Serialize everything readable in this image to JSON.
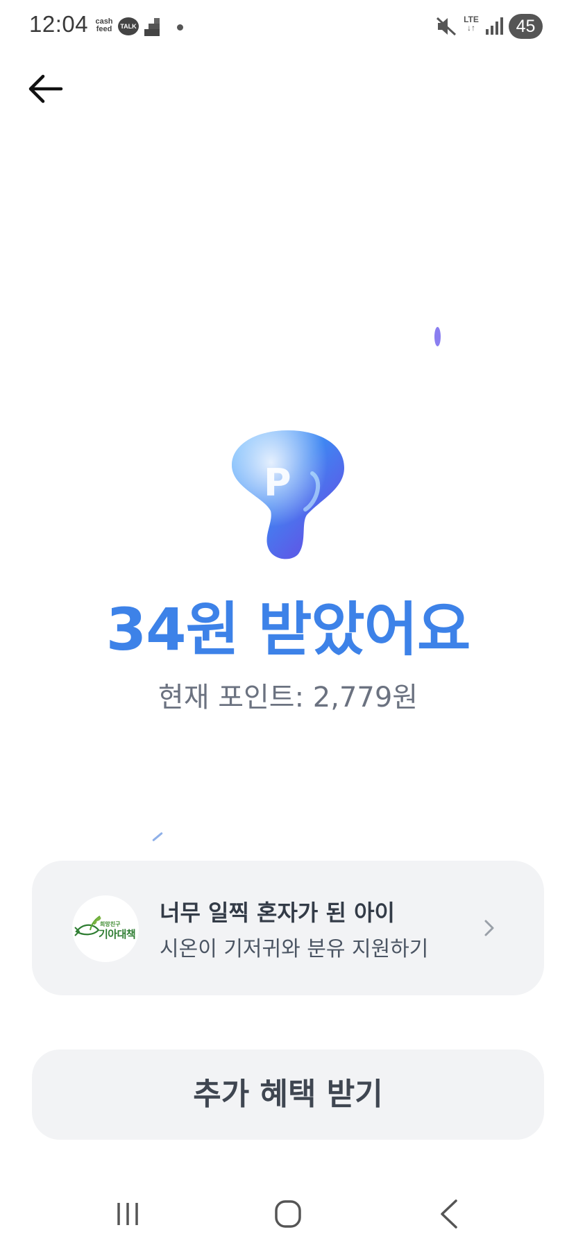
{
  "status_bar": {
    "time": "12:04",
    "cashfeed_label": "cash feed",
    "talk_label": "TALK",
    "network_label": "LTE",
    "battery_level": "45",
    "icons": [
      "cashfeed-icon",
      "kakaotalk-icon",
      "steps-icon",
      "notification-dot-icon",
      "mute-icon",
      "lte-icon",
      "signal-icon",
      "battery-icon"
    ]
  },
  "header": {
    "back_icon": "arrow-left-icon"
  },
  "reward": {
    "icon": "point-balloon-icon",
    "title": "34원 받았어요",
    "current_points": "현재 포인트: 2,779원"
  },
  "donation": {
    "logo_tagline": "희망친구",
    "logo_name": "기아대책",
    "title": "너무 일찍 혼자가 된 아이",
    "description": "시온이 기저귀와 분유 지원하기",
    "chevron_icon": "chevron-right-icon"
  },
  "actions": {
    "extra_benefit_label": "추가 혜택 받기"
  },
  "nav_bar": {
    "icons": [
      "recent-apps-icon",
      "home-icon",
      "back-icon"
    ]
  },
  "colors": {
    "accent": "#3d82e8",
    "card_bg": "#f2f3f5",
    "subtext": "#6b7280",
    "logo_green": "#2e7d32"
  }
}
